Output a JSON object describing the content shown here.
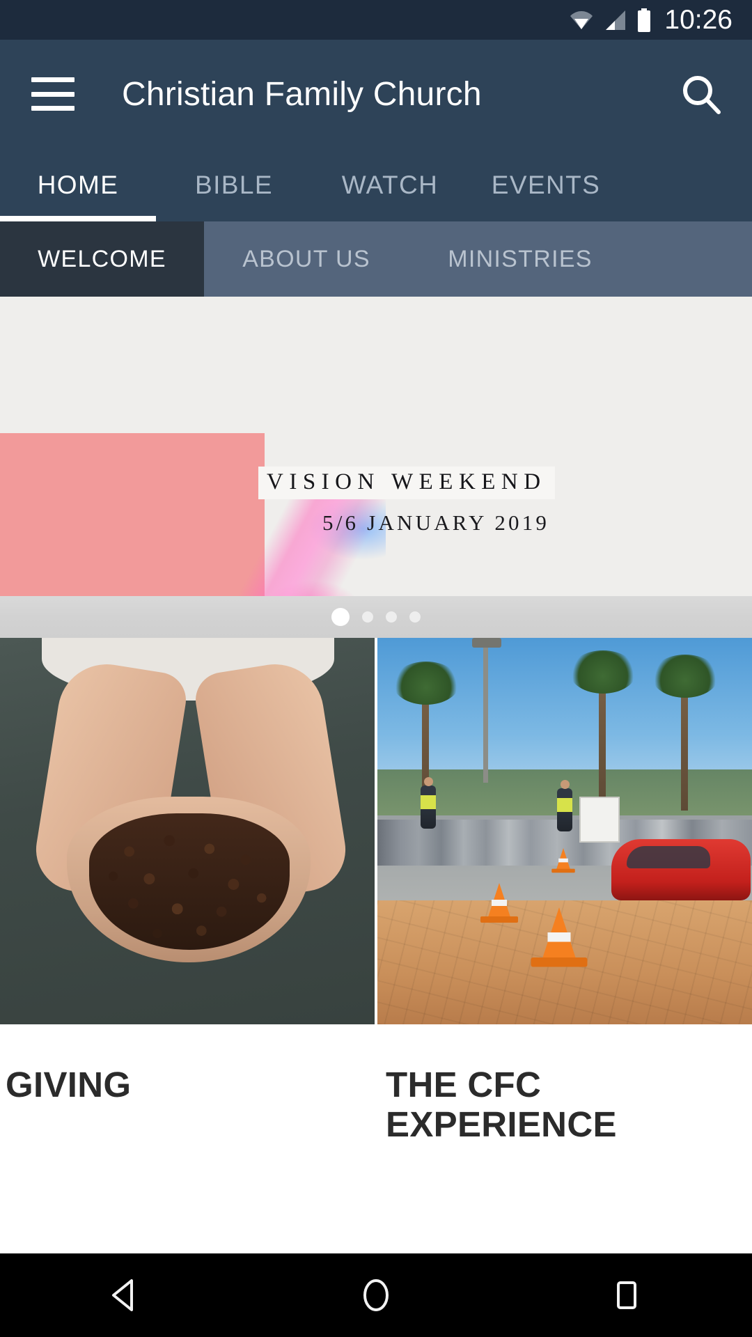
{
  "status_bar": {
    "time": "10:26",
    "icons": [
      "wifi-icon",
      "signal-icon",
      "battery-icon"
    ]
  },
  "app_bar": {
    "menu_icon": "hamburger-menu-icon",
    "title": "Christian Family Church",
    "search_icon": "search-icon"
  },
  "primary_tabs": {
    "active_index": 0,
    "items": [
      {
        "label": "HOME"
      },
      {
        "label": "BIBLE"
      },
      {
        "label": "WATCH"
      },
      {
        "label": "EVENTS"
      }
    ]
  },
  "secondary_tabs": {
    "active_index": 0,
    "items": [
      {
        "label": "WELCOME"
      },
      {
        "label": "ABOUT US"
      },
      {
        "label": "MINISTRIES"
      }
    ]
  },
  "hero_carousel": {
    "slide": {
      "title": "VISION WEEKEND",
      "subtitle": "5/6 JANUARY 2019"
    },
    "dots_total": 4,
    "dots_active_index": 0
  },
  "cards": [
    {
      "title": "GIVING",
      "image": "hands-holding-coffee-beans-photo"
    },
    {
      "title": "THE CFC EXPERIENCE",
      "image": "church-parking-lot-photo"
    }
  ],
  "nav_bar": {
    "back": "back-triangle-icon",
    "home": "home-circle-icon",
    "recents": "recents-square-icon"
  },
  "colors": {
    "status_bar_bg": "#1d2b3d",
    "app_bar_bg": "#2e4358",
    "subtab_bg": "#54657c",
    "subtab_active_bg": "#2b3540",
    "hero_bg": "#efeeec",
    "accent_salmon": "#f29a9a",
    "nav_bar_bg": "#000000"
  }
}
